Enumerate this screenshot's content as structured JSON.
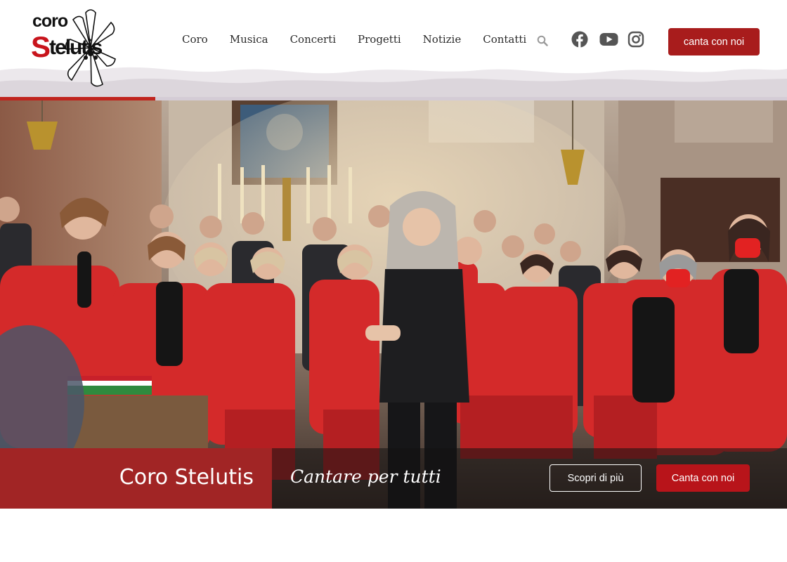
{
  "logo": {
    "line1": "coro",
    "initial": "S",
    "rest": "telutis"
  },
  "nav": {
    "items": [
      {
        "label": "Coro"
      },
      {
        "label": "Musica"
      },
      {
        "label": "Concerti"
      },
      {
        "label": "Progetti"
      },
      {
        "label": "Notizie"
      },
      {
        "label": "Contatti"
      }
    ]
  },
  "icons": {
    "search": "search-icon",
    "facebook": "facebook-icon",
    "youtube": "youtube-icon",
    "instagram": "instagram-icon"
  },
  "header": {
    "cta_label": "canta con noi"
  },
  "scroll_progress_fraction": 0.197,
  "hero": {
    "title": "Coro Stelutis",
    "subtitle": "Cantare per tutti",
    "primary_button": "Scopri di più",
    "secondary_button": "Canta con noi"
  },
  "colors": {
    "brand_red": "#a81c1c",
    "progress_red": "#c0241e",
    "progress_track": "#d4ccd6",
    "uniform_red": "#d42a2a"
  }
}
